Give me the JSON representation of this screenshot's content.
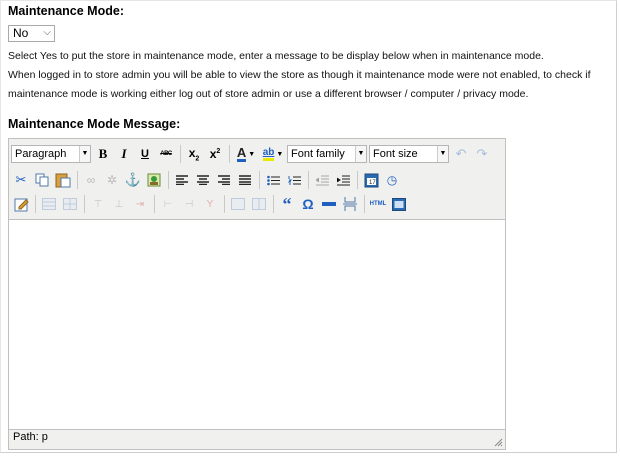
{
  "maintenance": {
    "mode_label": "Maintenance Mode:",
    "mode_value": "No",
    "desc_lines": [
      "Select Yes to put the store in maintenance mode, enter a message to be display below when in maintenance mode.",
      "When logged in to store admin you will be able to view the store as though it maintenance mode were not enabled, to check if",
      "maintenance mode is working either log out of store admin or use a different browser / computer / privacy mode."
    ],
    "message_label": "Maintenance Mode Message:"
  },
  "editor": {
    "format_select": "Paragraph",
    "font_family": "Font family",
    "font_size": "Font size",
    "path_text": "Path: p",
    "icons": {
      "bold": "B",
      "italic": "I",
      "underline": "U",
      "strike": "ABC",
      "sub": "x",
      "sup": "x",
      "font_color": "A",
      "highlight": "ab",
      "quote": "“",
      "omega": "Ω",
      "html": "HTML"
    }
  },
  "colors": {
    "accent_blue": "#1f5fbf",
    "toolbar_bg": "#f0f0ee",
    "border": "#c0c0c0"
  }
}
